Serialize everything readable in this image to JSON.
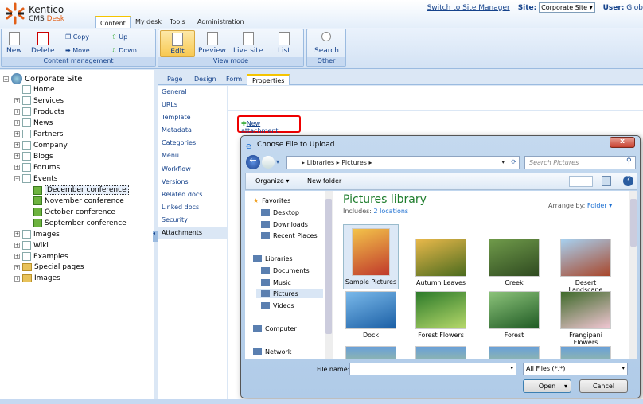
{
  "header": {
    "logo_line1": "Kentico",
    "logo_line2a": "CMS",
    "logo_line2b": "Desk",
    "tabs": [
      "Content",
      "My desk",
      "Tools",
      "Administration"
    ],
    "switch_link": "Switch to Site Manager",
    "site_label": "Site:",
    "site_value": "Corporate Site",
    "user_label": "User:",
    "user_value": "Glob"
  },
  "toolbar": {
    "groups": [
      {
        "label": "Content management",
        "buttons": [
          "New",
          "Delete"
        ],
        "small": [
          "Copy",
          "Move",
          "Up",
          "Down"
        ]
      },
      {
        "label": "View mode",
        "buttons": [
          "Edit",
          "Preview",
          "Live site",
          "List"
        ]
      },
      {
        "label": "Other",
        "buttons": [
          "Search"
        ]
      }
    ]
  },
  "tree": {
    "root": "Corporate Site",
    "items": [
      "Home",
      "Services",
      "Products",
      "News",
      "Partners",
      "Company",
      "Blogs",
      "Forums",
      "Events"
    ],
    "events": [
      "December conference",
      "November conference",
      "October conference",
      "September conference"
    ],
    "after": [
      "Images",
      "Wiki",
      "Examples",
      "Special pages",
      "Images"
    ]
  },
  "page_tabs": [
    "Page",
    "Design",
    "Form",
    "Properties"
  ],
  "properties_menu": [
    "General",
    "URLs",
    "Template",
    "Metadata",
    "Categories",
    "Menu",
    "Workflow",
    "Versions",
    "Related docs",
    "Linked docs",
    "Security",
    "Attachments"
  ],
  "new_attachment": "New attachment",
  "dialog": {
    "title": "Choose File to Upload",
    "close": "x",
    "breadcrumb": [
      "Libraries",
      "Pictures"
    ],
    "search_placeholder": "Search Pictures",
    "organize": "Organize",
    "new_folder": "New folder",
    "nav": {
      "favorites": "Favorites",
      "fav_items": [
        "Desktop",
        "Downloads",
        "Recent Places"
      ],
      "libraries": "Libraries",
      "lib_items": [
        "Documents",
        "Music",
        "Pictures",
        "Videos"
      ],
      "computer": "Computer",
      "network": "Network"
    },
    "library_title": "Pictures library",
    "includes_label": "Includes:",
    "includes_link": "2 locations",
    "arrange_label": "Arrange by:",
    "arrange_value": "Folder",
    "files": [
      {
        "name": "Sample Pictures",
        "c": [
          "#f3c34a",
          "#c0392b"
        ]
      },
      {
        "name": "Autumn Leaves",
        "c": [
          "#e8b84a",
          "#4b6b1e"
        ]
      },
      {
        "name": "Creek",
        "c": [
          "#6f9a4a",
          "#2f4a20"
        ]
      },
      {
        "name": "Desert Landscape",
        "c": [
          "#a7d0ef",
          "#a9462a"
        ]
      },
      {
        "name": "Dock",
        "c": [
          "#7ab9ea",
          "#1b5fa5"
        ]
      },
      {
        "name": "Forest Flowers",
        "c": [
          "#2c7a2a",
          "#b6d86a"
        ]
      },
      {
        "name": "Forest",
        "c": [
          "#8cc37a",
          "#1f5a24"
        ]
      },
      {
        "name": "Frangipani Flowers",
        "c": [
          "#3e6a2a",
          "#f2c6d4"
        ]
      }
    ],
    "file_name_label": "File name:",
    "file_name_value": "",
    "file_type": "All Files (*.*)",
    "open": "Open",
    "cancel": "Cancel"
  }
}
